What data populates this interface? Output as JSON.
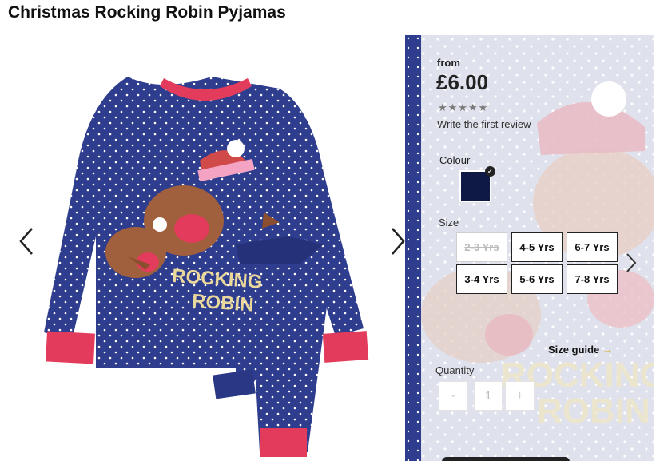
{
  "product": {
    "title": "Christmas Rocking Robin Pyjamas",
    "image_text_line1": "ROCKING",
    "image_text_line2": "ROBIN"
  },
  "gallery": {
    "prev_icon": "chevron-left-icon",
    "next_icon": "chevron-right-icon"
  },
  "pricing": {
    "from_label": "from",
    "price": "£6.00",
    "stars": "★★★★★",
    "review_link": "Write the first review"
  },
  "colour": {
    "label": "Colour",
    "selected_hex": "#0e1a45",
    "check": "✓"
  },
  "size": {
    "label": "Size",
    "options": [
      {
        "label": "2-3 Yrs",
        "available": false
      },
      {
        "label": "4-5 Yrs",
        "available": true
      },
      {
        "label": "6-7 Yrs",
        "available": true
      },
      {
        "label": "3-4 Yrs",
        "available": true
      },
      {
        "label": "5-6 Yrs",
        "available": true
      },
      {
        "label": "7-8 Yrs",
        "available": true
      }
    ],
    "guide_label": "Size guide",
    "guide_arrow": "→"
  },
  "quantity": {
    "label": "Quantity",
    "minus": "-",
    "value": "1",
    "plus": "+"
  },
  "colors": {
    "navy": "#2b3a86",
    "pink": "#e8395a",
    "panel_bg": "#dfe3ee"
  }
}
